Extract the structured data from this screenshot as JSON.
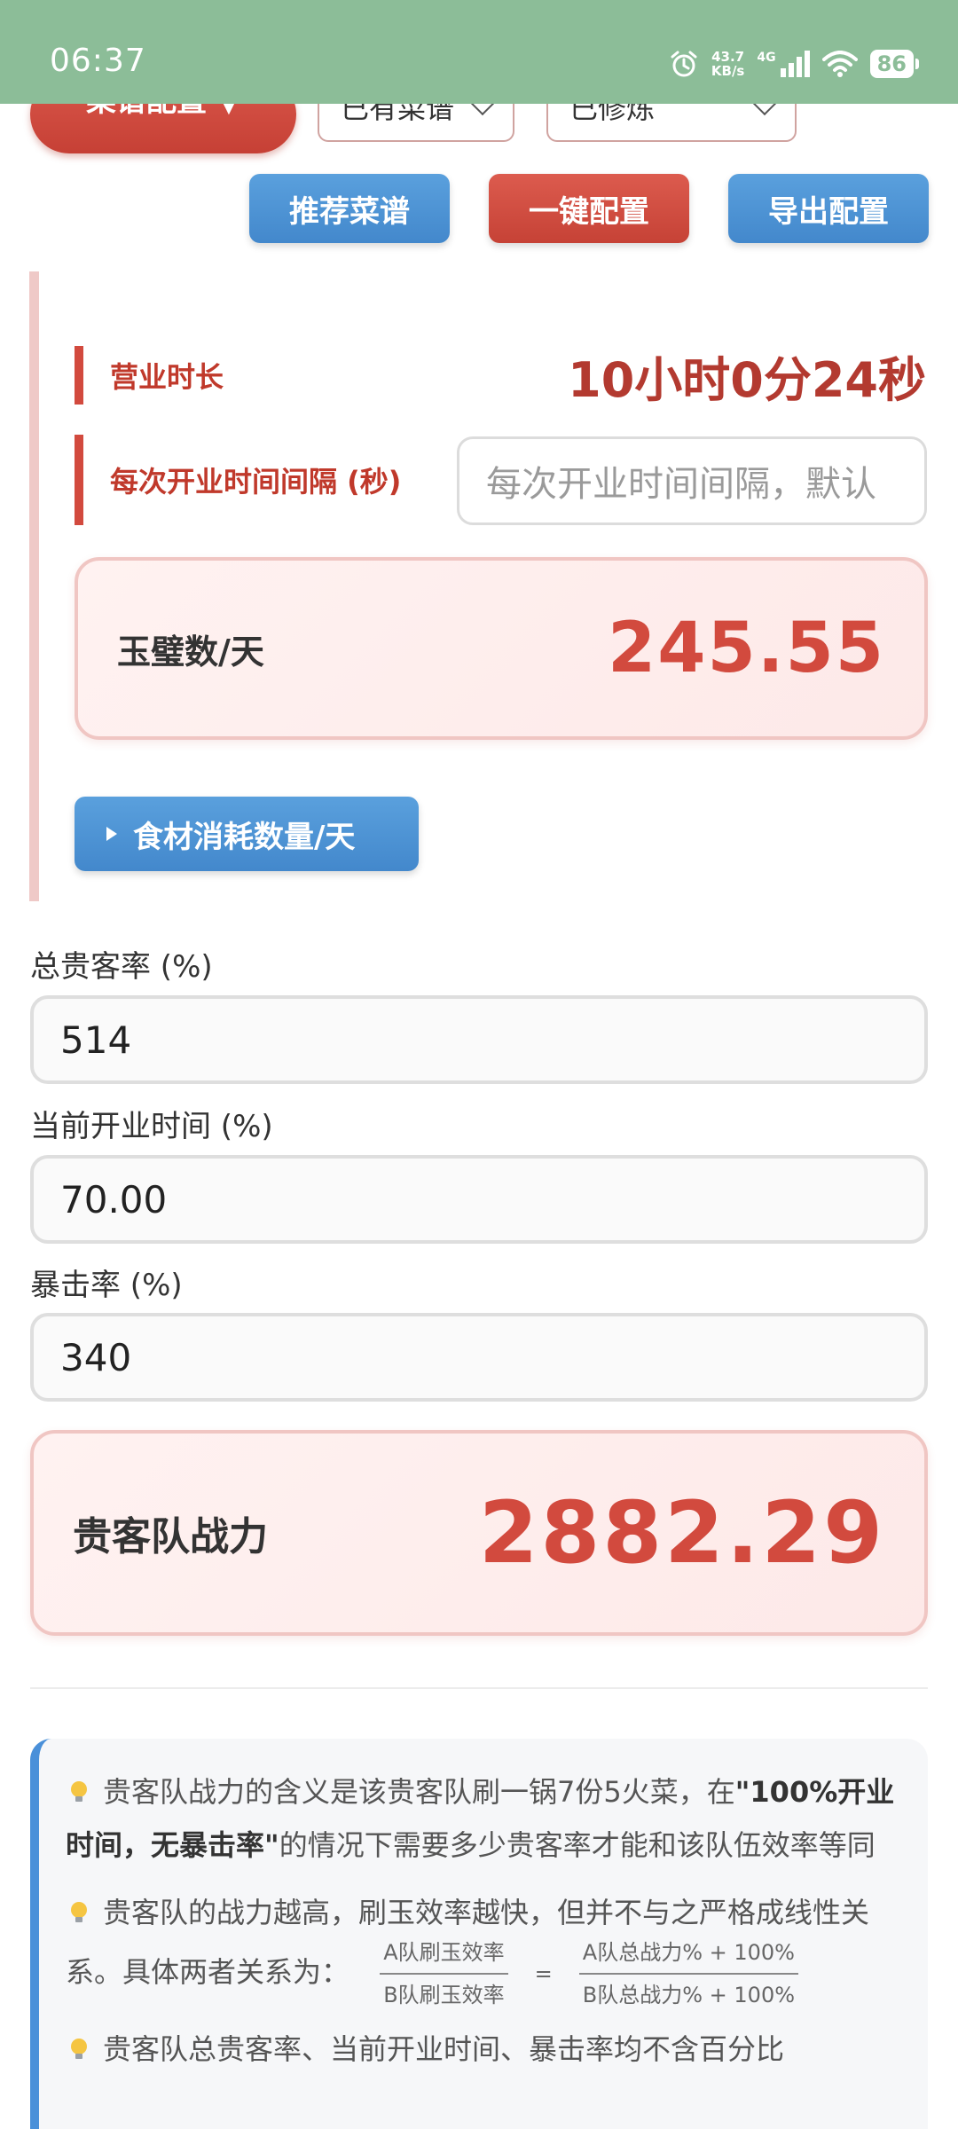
{
  "status_bar": {
    "time": "06:37",
    "net_speed_value": "43.7",
    "net_speed_unit": "KB/s",
    "network": "4G",
    "battery": "86",
    "icons": [
      "alarm-icon",
      "signal-icon",
      "wifi-icon",
      "battery-icon"
    ]
  },
  "top": {
    "config_button": "菜谱配置 ▼",
    "select_recipes": "已有菜谱",
    "select_cultivation": "已修炼",
    "recommend_button": "推荐菜谱",
    "onekey_button": "一键配置",
    "export_button": "导出配置"
  },
  "panel": {
    "hours_label": "营业时长",
    "hours_value": "10小时0分24秒",
    "interval_label": "每次开业时间间隔 (秒)",
    "interval_placeholder": "每次开业时间间隔，默认",
    "jade_label": "玉璧数/天",
    "jade_value": "245.55",
    "ingredient_button": "食材消耗数量/天"
  },
  "fields": {
    "total_guest_rate_label": "总贵客率 (%)",
    "total_guest_rate_value": "514",
    "current_open_time_label": "当前开业时间 (%)",
    "current_open_time_value": "70.00",
    "crit_rate_label": "暴击率 (%)",
    "crit_rate_value": "340"
  },
  "power": {
    "label": "贵客队战力",
    "value": "2882.29"
  },
  "info": {
    "p1_a": "贵客队战力的含义是该贵客队刷一锅7份5火菜，在",
    "p1_bold": "\"100%开业时间，无暴击率\"",
    "p1_b": "的情况下需要多少贵客率才能和该队伍效率等同",
    "p2": "贵客队的战力越高，刷玉效率越快，但并不与之严格成线性关系。具体两者关系为：",
    "formula_left_num": "A队刷玉效率",
    "formula_left_den": "B队刷玉效率",
    "formula_eq": "=",
    "formula_right_num": "A队总战力% + 100%",
    "formula_right_den": "B队总战力% + 100%",
    "p3": "贵客队总贵客率、当前开业时间、暴击率均不含百分比"
  }
}
